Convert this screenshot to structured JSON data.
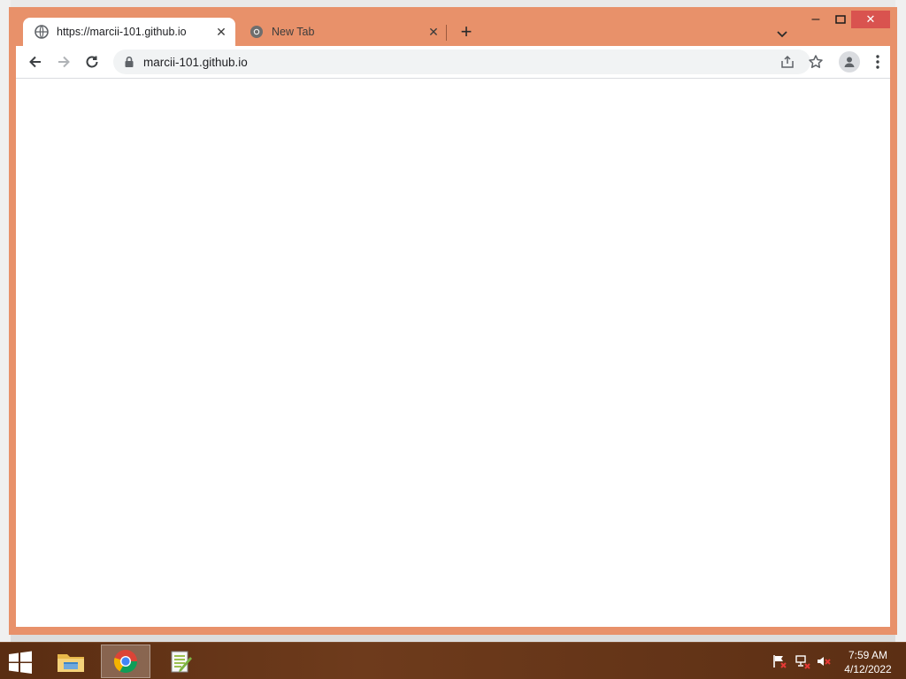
{
  "browser": {
    "tabs": [
      {
        "title": "https://marcii-101.github.io",
        "icon": "globe-icon",
        "active": true
      },
      {
        "title": "New Tab",
        "icon": "chrome-icon",
        "active": false
      }
    ],
    "new_tab_glyph": "+",
    "close_glyph": "✕",
    "address_bar": {
      "url": "marcii-101.github.io"
    },
    "window_controls": {
      "minimize": "–",
      "maximize": "□",
      "close": "✕"
    }
  },
  "taskbar": {
    "apps": [
      {
        "name": "file-explorer",
        "icon": "folder-icon"
      },
      {
        "name": "google-chrome",
        "icon": "chrome-icon",
        "active": true
      },
      {
        "name": "notepad-plus-plus",
        "icon": "notepad-icon"
      }
    ],
    "clock": {
      "time": "7:59 AM",
      "date": "4/12/2022"
    }
  },
  "colors": {
    "frame": "#e8916a",
    "close_button": "#d9534f",
    "taskbar": "#5a2d12"
  }
}
